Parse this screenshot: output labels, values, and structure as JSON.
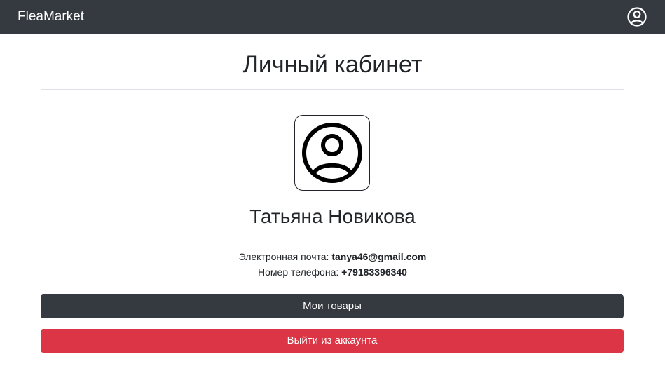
{
  "navbar": {
    "brand": "FleaMarket",
    "account_icon": "person-circle-icon"
  },
  "profile": {
    "title": "Личный кабинет",
    "avatar_icon": "person-circle-icon",
    "name": "Татьяна Новикова",
    "email_label": "Электронная почта:",
    "email": "tanya46@gmail.com",
    "phone_label": "Номер телефона:",
    "phone": "+79183396340"
  },
  "actions": {
    "my_items": "Мои товары",
    "logout": "Выйти из аккаунта"
  },
  "colors": {
    "navbar": "#343a40",
    "primary_button": "#343a40",
    "danger_button": "#dc3545",
    "text": "#212529"
  }
}
